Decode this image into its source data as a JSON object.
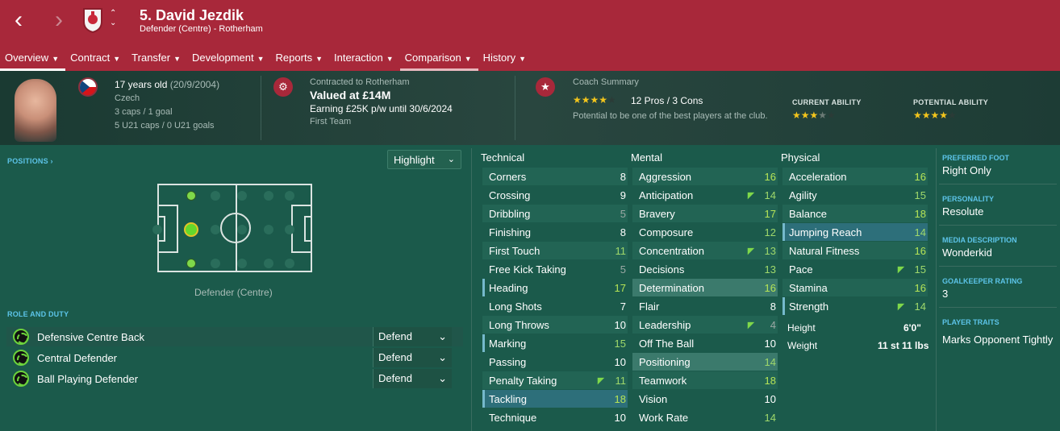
{
  "header": {
    "back_glyph": "‹",
    "forward_glyph": "›",
    "title": "5. David Jezdik",
    "subtitle": "Defender (Centre) - Rotherham",
    "brand_color": "#a8283a"
  },
  "tabs": [
    "Overview",
    "Contract",
    "Transfer",
    "Development",
    "Reports",
    "Interaction",
    "Comparison",
    "History"
  ],
  "profile": {
    "age": "17 years old",
    "dob": "(20/9/2004)",
    "nationality": "Czech",
    "caps": "3 caps / 1 goal",
    "u21": "5 U21 caps / 0 U21 goals"
  },
  "contract": {
    "club_line": "Contracted to Rotherham",
    "value": "Valued at £14M",
    "earning": "Earning £25K p/w until 30/6/2024",
    "squad": "First Team"
  },
  "coach": {
    "heading": "Coach Summary",
    "stars": 4,
    "pros_cons": "12 Pros / 3 Cons",
    "summary": "Potential to be one of the best players at the club.",
    "current_label": "CURRENT ABILITY",
    "current_stars": 3.5,
    "potential_label": "POTENTIAL ABILITY",
    "potential_stars": 4
  },
  "positions": {
    "label": "POSITIONS",
    "highlight": "Highlight",
    "position_name": "Defender (Centre)"
  },
  "roles": {
    "label": "ROLE AND DUTY",
    "items": [
      {
        "name": "Defensive Centre Back",
        "duty": "Defend"
      },
      {
        "name": "Central Defender",
        "duty": "Defend"
      },
      {
        "name": "Ball Playing Defender",
        "duty": "Defend"
      }
    ]
  },
  "attributes": {
    "technical_title": "Technical",
    "mental_title": "Mental",
    "physical_title": "Physical",
    "technical": [
      {
        "name": "Corners",
        "value": "8"
      },
      {
        "name": "Crossing",
        "value": "9"
      },
      {
        "name": "Dribbling",
        "value": "5"
      },
      {
        "name": "Finishing",
        "value": "8"
      },
      {
        "name": "First Touch",
        "value": "11"
      },
      {
        "name": "Free Kick Taking",
        "value": "5"
      },
      {
        "name": "Heading",
        "value": "17"
      },
      {
        "name": "Long Shots",
        "value": "7"
      },
      {
        "name": "Long Throws",
        "value": "10"
      },
      {
        "name": "Marking",
        "value": "15"
      },
      {
        "name": "Passing",
        "value": "10"
      },
      {
        "name": "Penalty Taking",
        "value": "11"
      },
      {
        "name": "Tackling",
        "value": "18"
      },
      {
        "name": "Technique",
        "value": "10"
      }
    ],
    "mental": [
      {
        "name": "Aggression",
        "value": "16"
      },
      {
        "name": "Anticipation",
        "value": "14"
      },
      {
        "name": "Bravery",
        "value": "17"
      },
      {
        "name": "Composure",
        "value": "12"
      },
      {
        "name": "Concentration",
        "value": "13"
      },
      {
        "name": "Decisions",
        "value": "13"
      },
      {
        "name": "Determination",
        "value": "16"
      },
      {
        "name": "Flair",
        "value": "8"
      },
      {
        "name": "Leadership",
        "value": "4"
      },
      {
        "name": "Off The Ball",
        "value": "10"
      },
      {
        "name": "Positioning",
        "value": "14"
      },
      {
        "name": "Teamwork",
        "value": "18"
      },
      {
        "name": "Vision",
        "value": "10"
      },
      {
        "name": "Work Rate",
        "value": "14"
      }
    ],
    "physical": [
      {
        "name": "Acceleration",
        "value": "16"
      },
      {
        "name": "Agility",
        "value": "15"
      },
      {
        "name": "Balance",
        "value": "18"
      },
      {
        "name": "Jumping Reach",
        "value": "14"
      },
      {
        "name": "Natural Fitness",
        "value": "16"
      },
      {
        "name": "Pace",
        "value": "15"
      },
      {
        "name": "Stamina",
        "value": "16"
      },
      {
        "name": "Strength",
        "value": "14"
      }
    ],
    "height_label": "Height",
    "height": "6'0\"",
    "weight_label": "Weight",
    "weight": "11 st 11 lbs"
  },
  "info": {
    "foot_label": "PREFERRED FOOT",
    "foot": "Right Only",
    "personality_label": "PERSONALITY",
    "personality": "Resolute",
    "media_label": "MEDIA DESCRIPTION",
    "media": "Wonderkid",
    "gk_label": "GOALKEEPER RATING",
    "gk": "3",
    "traits_label": "PLAYER TRAITS",
    "traits": "Marks Opponent Tightly"
  }
}
